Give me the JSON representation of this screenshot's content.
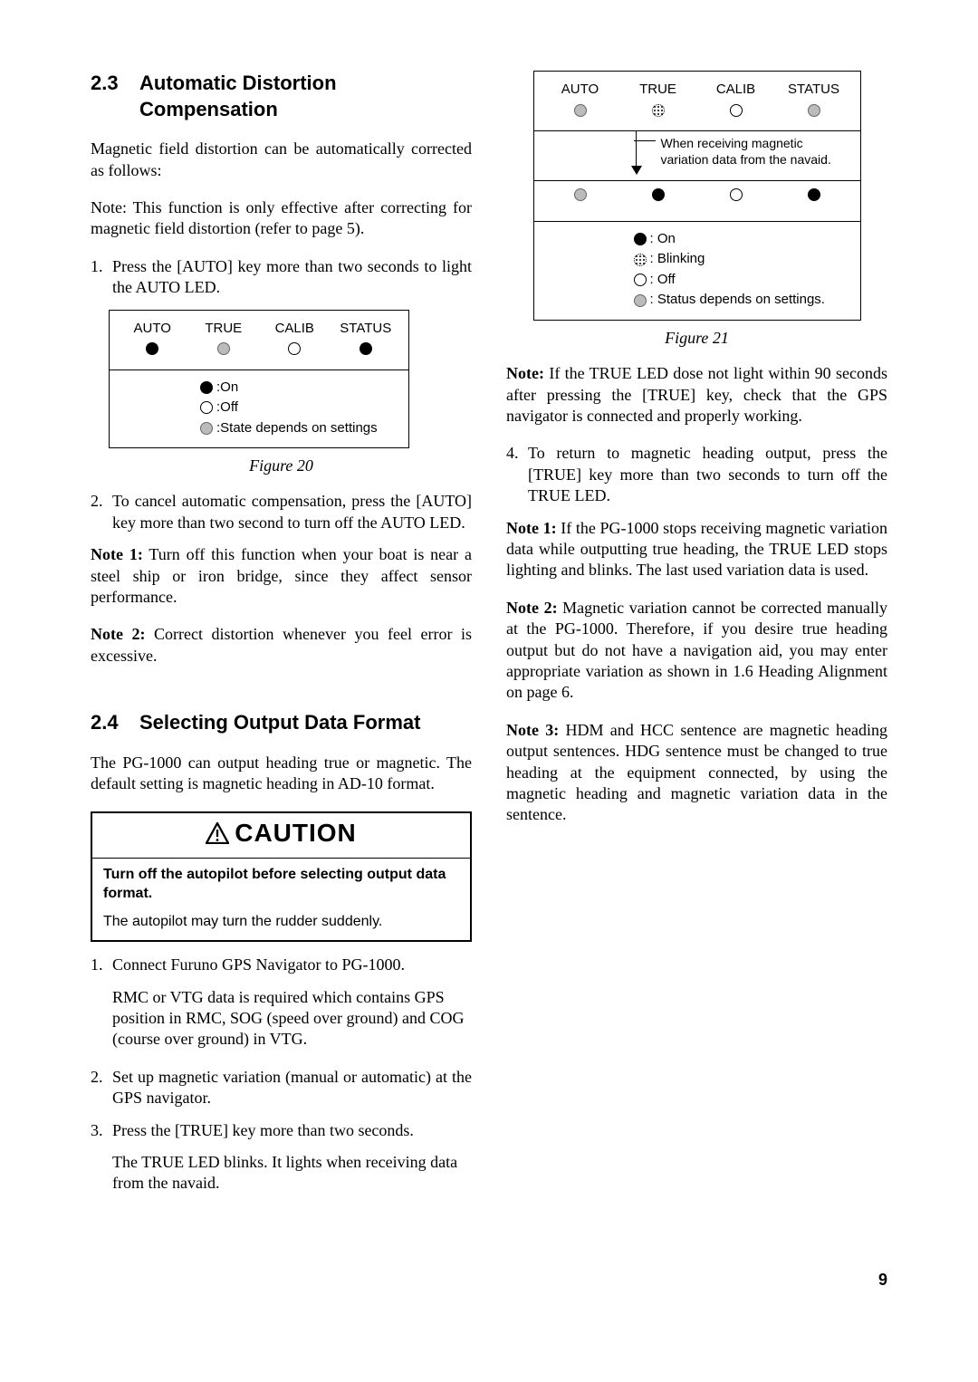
{
  "page_number": "9",
  "left": {
    "h23_num": "2.3",
    "h23_title": "Automatic Distortion Compensation",
    "p1": "Magnetic field distortion can be automatically corrected as follows:",
    "p2": "Note: This function is only effective after correcting for magnetic field distortion (refer to page 5).",
    "li1_marker": "1.",
    "li1": "Press the [AUTO] key more than two seconds to light the AUTO LED.",
    "fig20_labels": {
      "auto": "AUTO",
      "true": "TRUE",
      "calib": "CALIB",
      "status": "STATUS"
    },
    "fig20_legend_on": ":On",
    "fig20_legend_off": ":Off",
    "fig20_legend_state": ":State depends on settings",
    "fig20_caption": "Figure 20",
    "li2_marker": "2.",
    "li2": "To cancel automatic compensation, press the [AUTO] key more than two second to turn off the AUTO LED.",
    "note1_label": "Note 1:",
    "note1": " Turn off this function when your boat is near a steel ship or iron bridge, since they affect sensor performance.",
    "note2_label": "Note 2:",
    "note2": " Correct distortion whenever you feel error is excessive.",
    "h24_num": "2.4",
    "h24_title": "Selecting Output Data Format",
    "p24_1": "The PG-1000 can output heading true or magnetic. The default setting is magnetic heading in AD-10 format.",
    "caution_title": "CAUTION",
    "caution_bold": "Turn off the autopilot before selecting output data format.",
    "caution_body": "The autopilot may turn the rudder suddenly.",
    "li24_1_marker": "1.",
    "li24_1": "Connect Furuno GPS Navigator to PG-1000."
  },
  "right": {
    "cont": "RMC or VTG data is required which contains GPS position in RMC, SOG (speed over ground) and COG (course over ground) in VTG.",
    "li2_marker": "2.",
    "li2": "Set up magnetic variation (manual or automatic) at the GPS navigator.",
    "li3_marker": "3.",
    "li3": "Press the [TRUE] key more than two seconds.",
    "li3_sub": "The TRUE LED blinks. It lights when receiving data from the navaid.",
    "fig21_labels": {
      "auto": "AUTO",
      "true": "TRUE",
      "calib": "CALIB",
      "status": "STATUS"
    },
    "fig21_arrow": "When receiving magnetic variation data from the navaid.",
    "fig21_on": ": On",
    "fig21_blink": ": Blinking",
    "fig21_off": ": Off",
    "fig21_state": ": Status depends on settings.",
    "fig21_caption": "Figure 21",
    "note_r_label": "Note:",
    "note_r": " If the TRUE LED dose not light within 90 seconds after pressing the [TRUE] key, check that the GPS navigator is connected and properly working.",
    "li4_marker": "4.",
    "li4": "To return to magnetic heading output, press the [TRUE] key more than two seconds to turn off the TRUE LED.",
    "note1_label": "Note 1:",
    "note1": " If the PG-1000 stops receiving magnetic variation data while outputting true heading, the TRUE LED stops lighting and blinks. The last used variation data is used.",
    "note2_label": "Note 2:",
    "note2": " Magnetic variation cannot be corrected manually at the PG-1000. Therefore, if you desire true heading output but do not have a navigation aid, you may enter appropriate variation as shown in 1.6 Heading Alignment on page 6.",
    "note3_label": "Note 3:",
    "note3": " HDM and HCC sentence are magnetic heading output sentences. HDG sentence must be changed to true heading at the equipment connected, by using the magnetic heading and magnetic variation data in the sentence."
  }
}
